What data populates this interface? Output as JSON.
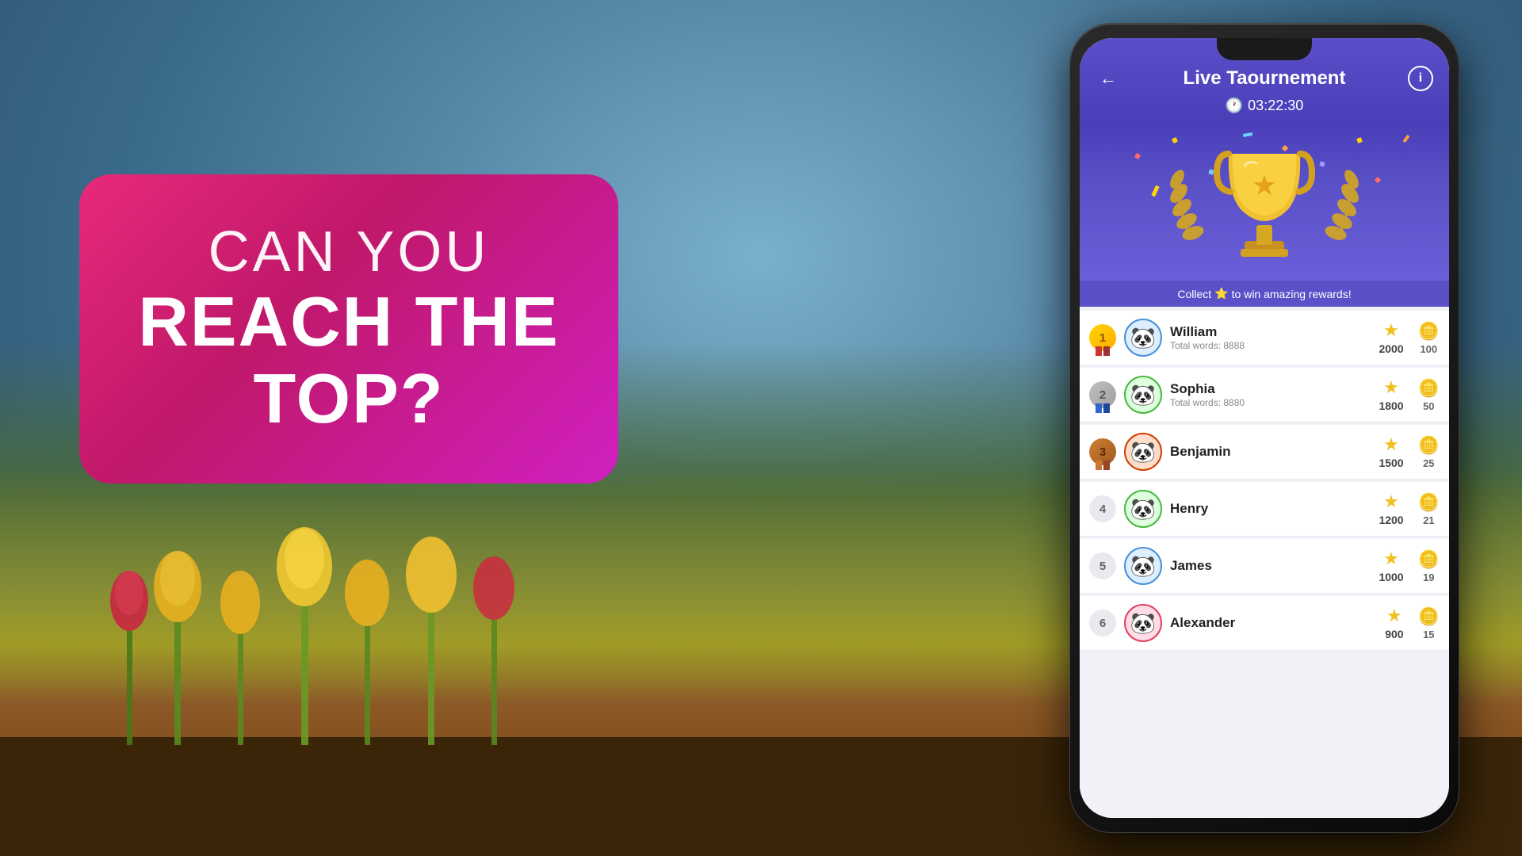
{
  "background": {
    "description": "Tulip field with mountains and cloudy sky"
  },
  "left_panel": {
    "line1": "CAN YOU",
    "line2": "REACH THE",
    "line3": "TOP?"
  },
  "app": {
    "header": {
      "title": "Live Taournement",
      "timer": "03:22:30",
      "back_label": "←",
      "info_label": "i"
    },
    "collect_bar": {
      "text": "Collect",
      "star": "⭐",
      "suffix": "to win amazing rewards!"
    },
    "leaderboard": [
      {
        "rank": 1,
        "rank_display": "1",
        "name": "William",
        "words": "Total words: 8888",
        "score": 2000,
        "coins": 100,
        "avatar_emoji": "🐼",
        "avatar_class": "avatar-1"
      },
      {
        "rank": 2,
        "rank_display": "2",
        "name": "Sophia",
        "words": "Total words: 8880",
        "score": 1800,
        "coins": 50,
        "avatar_emoji": "🐼",
        "avatar_class": "avatar-2"
      },
      {
        "rank": 3,
        "rank_display": "3",
        "name": "Benjamin",
        "words": "",
        "score": 1500,
        "coins": 25,
        "avatar_emoji": "🐼",
        "avatar_class": "avatar-3"
      },
      {
        "rank": 4,
        "rank_display": "4",
        "name": "Henry",
        "words": "",
        "score": 1200,
        "coins": 21,
        "avatar_emoji": "🐼",
        "avatar_class": "avatar-4"
      },
      {
        "rank": 5,
        "rank_display": "5",
        "name": "James",
        "words": "",
        "score": 1000,
        "coins": 19,
        "avatar_emoji": "🐼",
        "avatar_class": "avatar-5"
      },
      {
        "rank": 6,
        "rank_display": "6",
        "name": "Alexander",
        "words": "",
        "score": 900,
        "coins": 15,
        "avatar_emoji": "🐼",
        "avatar_class": "avatar-6"
      }
    ]
  }
}
